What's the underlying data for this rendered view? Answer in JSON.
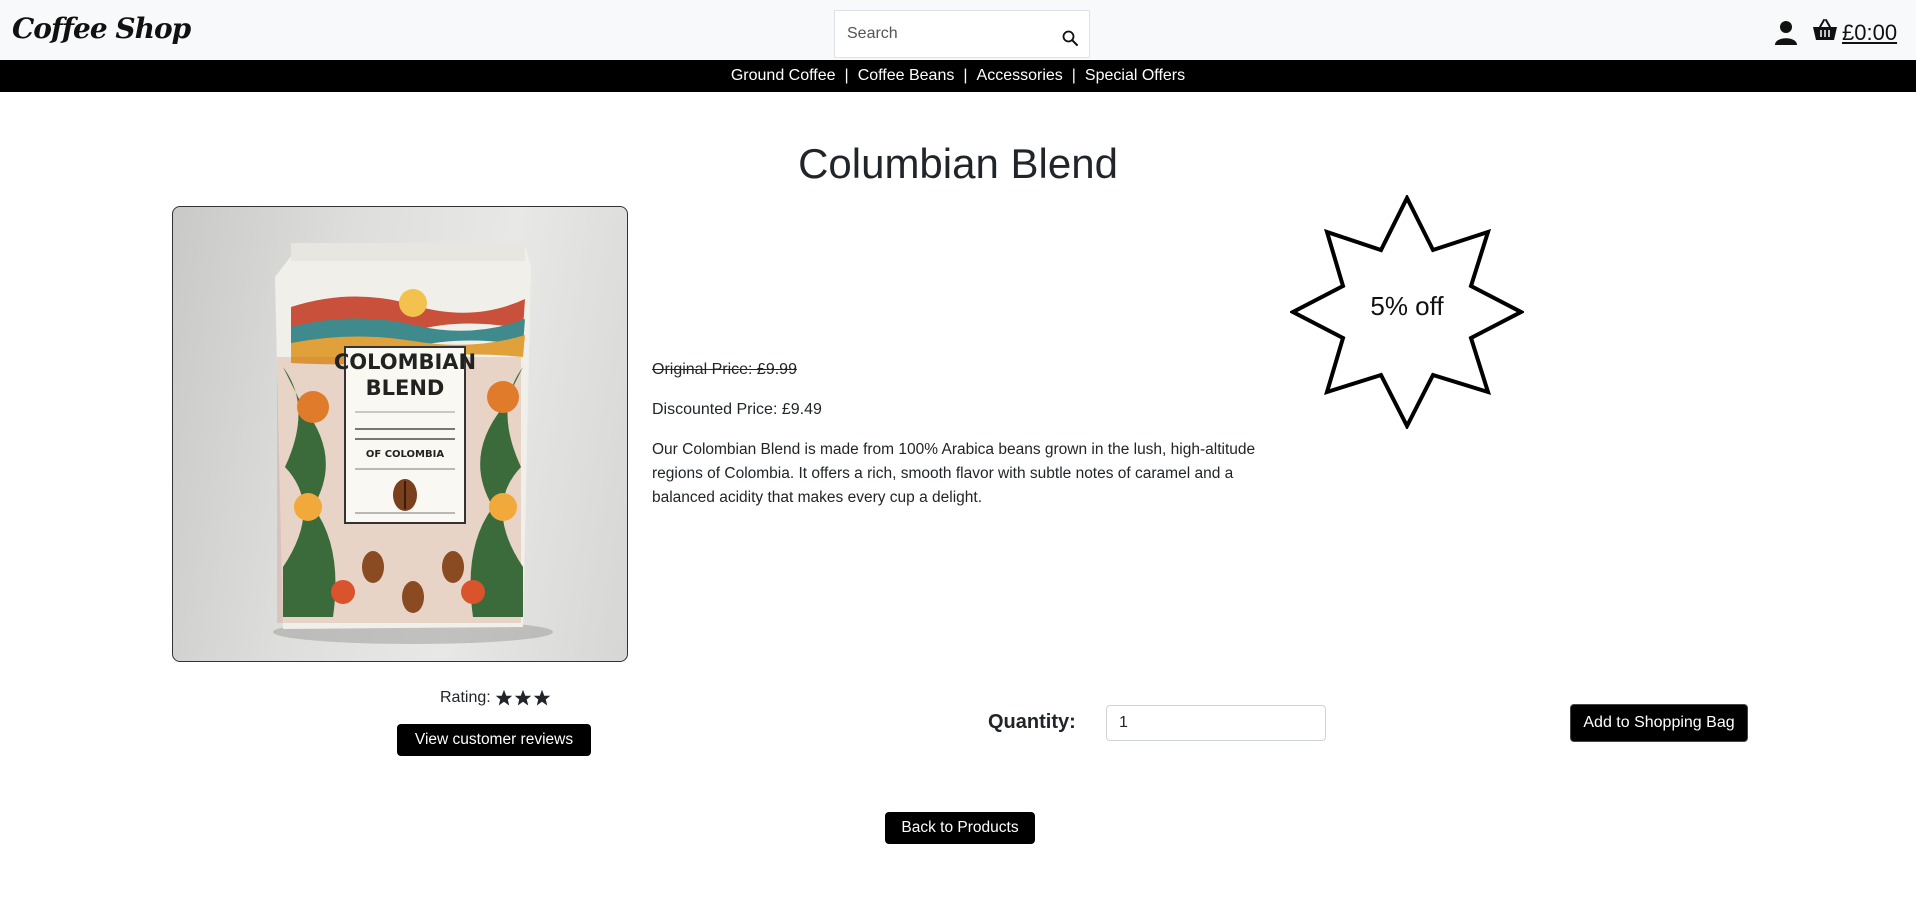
{
  "header": {
    "logo": "Coffee Shop",
    "search_placeholder": "Search",
    "bag_total": "£0:00"
  },
  "nav": {
    "items": [
      "Ground Coffee",
      "Coffee Beans",
      "Accessories",
      "Special Offers"
    ],
    "separator": "|"
  },
  "product": {
    "title": "Columbian Blend",
    "original_price": "Original Price: £9.99",
    "discounted_price": "Discounted Price: £9.49",
    "description": "Our Colombian Blend is made from 100% Arabica beans grown in the lush, high-altitude regions of Colombia. It offers a rich, smooth flavor with subtle notes of caramel and a balanced acidity that makes every cup a delight.",
    "discount_badge": "5% off",
    "image_text": {
      "line1": "COLOMBIAN",
      "line2": "BLEND",
      "line3": "OF COLOMBIA"
    },
    "rating_label": "Rating:",
    "rating_stars": 3,
    "reviews_button": "View customer reviews",
    "quantity_label": "Quantity:",
    "quantity_value": "1",
    "add_button": "Add to Shopping Bag",
    "back_button": "Back to Products"
  },
  "colors": {
    "header_bg": "#f8f9fa",
    "nav_bg": "#000000",
    "button_bg": "#000000",
    "text": "#212529"
  },
  "icons": {
    "search": "search-icon",
    "account": "user-icon",
    "bag": "basket-icon",
    "star": "star-icon"
  }
}
